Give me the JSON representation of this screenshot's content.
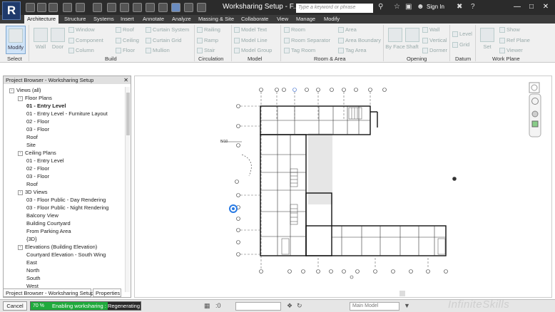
{
  "app": {
    "logo_letter": "R",
    "title": "Worksharing Setup - F..."
  },
  "search": {
    "placeholder": "Type a keyword or phrase"
  },
  "account": {
    "signin_label": "Sign In",
    "help_label": "?"
  },
  "icons": {
    "binoculars": "binoculars-icon",
    "star": "star-icon",
    "cart": "cart-icon",
    "user": "user-icon"
  },
  "tabs": [
    "Architecture",
    "Structure",
    "Systems",
    "Insert",
    "Annotate",
    "Analyze",
    "Massing & Site",
    "Collaborate",
    "View",
    "Manage",
    "Modify"
  ],
  "ribbon": {
    "modify": "Modify",
    "wall": "Wall",
    "door": "Door",
    "window": "Window",
    "component": "Component",
    "column": "Column",
    "roof": "Roof",
    "ceiling": "Ceiling",
    "floor": "Floor",
    "curtain_system": "Curtain System",
    "curtain_grid": "Curtain Grid",
    "mullion": "Mullion",
    "railing": "Railing",
    "ramp": "Ramp",
    "stair": "Stair",
    "model_text": "Model Text",
    "model_line": "Model Line",
    "model_group": "Model Group",
    "room": "Room",
    "room_separator": "Room Separator",
    "tag_room": "Tag Room",
    "area": "Area",
    "area_boundary": "Area Boundary",
    "tag_area": "Tag Area",
    "by_face": "By Face",
    "shaft": "Shaft",
    "op_wall": "Wall",
    "vertical": "Vertical",
    "dormer": "Dormer",
    "level": "Level",
    "grid": "Grid",
    "set": "Set",
    "show": "Show",
    "ref_plane": "Ref Plane",
    "viewer": "Viewer",
    "panels": [
      "Select",
      "Build",
      "Circulation",
      "Model",
      "Room & Area",
      "Opening",
      "Datum",
      "Work Plane"
    ]
  },
  "project_browser": {
    "header": "Project Browser - Worksharing Setup",
    "nodes": [
      {
        "label": "Views (all)",
        "level": 0,
        "toggle": "-"
      },
      {
        "label": "Floor Plans",
        "level": 1,
        "toggle": "-"
      },
      {
        "label": "01 - Entry Level",
        "level": 2,
        "bold": true
      },
      {
        "label": "01 - Entry Level - Furniture Layout",
        "level": 2
      },
      {
        "label": "02 - Floor",
        "level": 2
      },
      {
        "label": "03 - Floor",
        "level": 2
      },
      {
        "label": "Roof",
        "level": 2
      },
      {
        "label": "Site",
        "level": 2
      },
      {
        "label": "Ceiling Plans",
        "level": 1,
        "toggle": "-"
      },
      {
        "label": "01 - Entry Level",
        "level": 2
      },
      {
        "label": "02 - Floor",
        "level": 2
      },
      {
        "label": "03 - Floor",
        "level": 2
      },
      {
        "label": "Roof",
        "level": 2
      },
      {
        "label": "3D Views",
        "level": 1,
        "toggle": "-"
      },
      {
        "label": "03 - Floor Public - Day Rendering",
        "level": 2
      },
      {
        "label": "03 - Floor Public - Night Rendering",
        "level": 2
      },
      {
        "label": "Balcony View",
        "level": 2
      },
      {
        "label": "Building Courtyard",
        "level": 2
      },
      {
        "label": "From Parking Area",
        "level": 2
      },
      {
        "label": "{3D}",
        "level": 2
      },
      {
        "label": "Elevations (Building Elevation)",
        "level": 1,
        "toggle": "-"
      },
      {
        "label": "Courtyard Elevation - South Wing",
        "level": 2
      },
      {
        "label": "East",
        "level": 2
      },
      {
        "label": "North",
        "level": 2
      },
      {
        "label": "South",
        "level": 2
      },
      {
        "label": "West",
        "level": 2
      }
    ],
    "bottom_tabs": [
      "Project Browser - Worksharing Setup",
      "Properties"
    ]
  },
  "drawing": {
    "elevation_tag": "B/10"
  },
  "status": {
    "cancel": "Cancel",
    "progress_percent": 70,
    "progress_label": "70 %",
    "message": "Enabling worksharing : Regenerating",
    "main_model": "Main Model",
    "zero": ":0"
  },
  "watermark": "InfiniteSkills"
}
